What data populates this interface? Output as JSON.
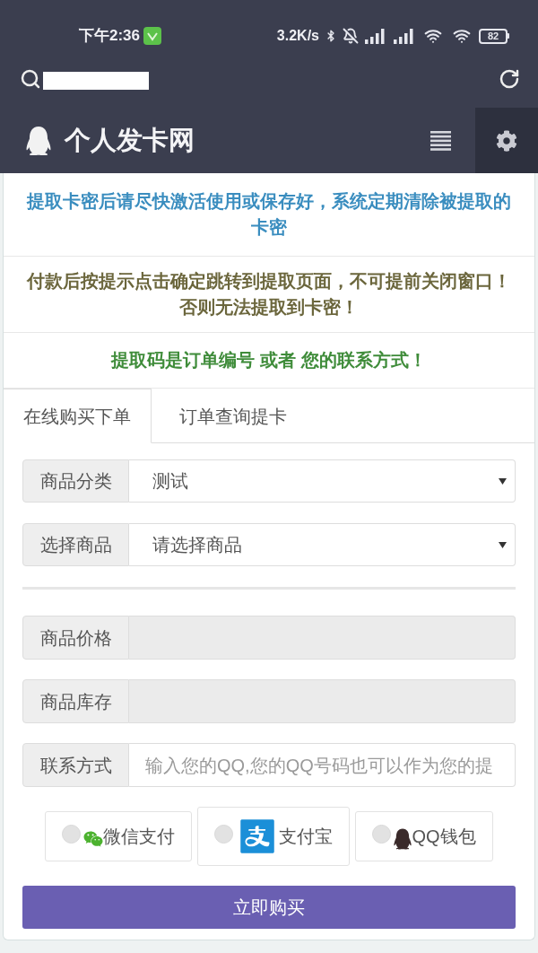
{
  "status_bar": {
    "time": "下午2:36",
    "net_speed": "3.2K/s",
    "battery": "82"
  },
  "header": {
    "title": "个人发卡网"
  },
  "notices": [
    {
      "kind": "info",
      "text": "提取卡密后请尽快激活使用或保存好，系统定期清除被提取的卡密"
    },
    {
      "kind": "warning",
      "text": "付款后按提示点击确定跳转到提取页面，不可提前关闭窗口！否则无法提取到卡密！"
    },
    {
      "kind": "success",
      "text": "提取码是订单编号 或者 您的联系方式！"
    }
  ],
  "tabs": [
    {
      "label": "在线购买下单",
      "selected": true
    },
    {
      "label": "订单查询提卡",
      "selected": false
    }
  ],
  "selects": [
    {
      "label": "商品分类",
      "value": "测试"
    },
    {
      "label": "选择商品",
      "value": "请选择商品"
    }
  ],
  "inputs": [
    {
      "label": "商品价格",
      "disabled": true
    },
    {
      "label": "商品库存",
      "disabled": true
    },
    {
      "label": "联系方式",
      "disabled": false,
      "placeholder": "输入您的QQ,您的QQ号码也可以作为您的提"
    }
  ],
  "payment_methods": [
    {
      "kind": "wechat",
      "label": "微信支付",
      "selected": false
    },
    {
      "kind": "alipay",
      "label": "支付宝",
      "selected": false
    },
    {
      "kind": "qq",
      "label": "QQ钱包",
      "selected": false
    }
  ],
  "submit_button": "立即购买"
}
